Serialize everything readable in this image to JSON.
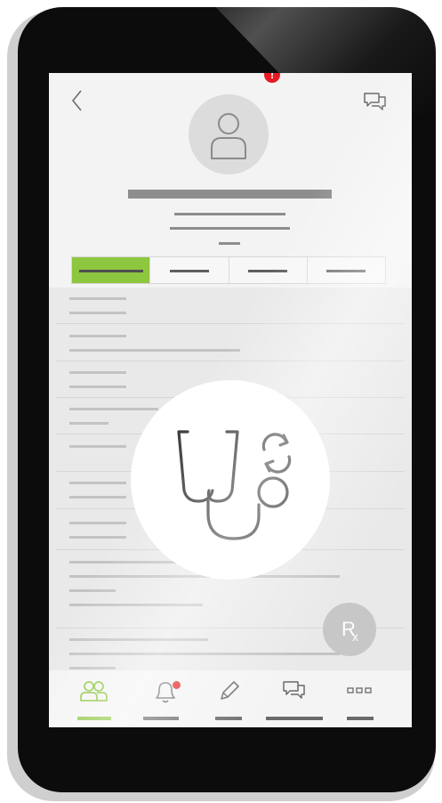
{
  "colors": {
    "accent": "#8dc63f",
    "alert": "#e31b23",
    "phone_body": "#0c0c0c",
    "screen_bg": "#f3f3f3",
    "placeholder_bar": "#8d8d8d"
  },
  "header": {
    "back_icon": "chevron-left-icon",
    "chat_icon": "chat-bubbles-icon",
    "avatar_icon": "user-silhouette-icon"
  },
  "tabs": {
    "count": 4,
    "active_index": 0,
    "alert_tab_index": 2,
    "alert_badge": "!"
  },
  "overlay": {
    "icon": "stethoscope-refresh-icon"
  },
  "fab": {
    "label": "R",
    "sublabel": "x",
    "icon": "prescription-rx-icon"
  },
  "bottom_nav": {
    "items": [
      {
        "icon": "people-icon",
        "active": true
      },
      {
        "icon": "bell-icon",
        "notification_dot": true
      },
      {
        "icon": "pencil-icon"
      },
      {
        "icon": "chat-icon"
      },
      {
        "icon": "more-dots-icon"
      }
    ]
  }
}
